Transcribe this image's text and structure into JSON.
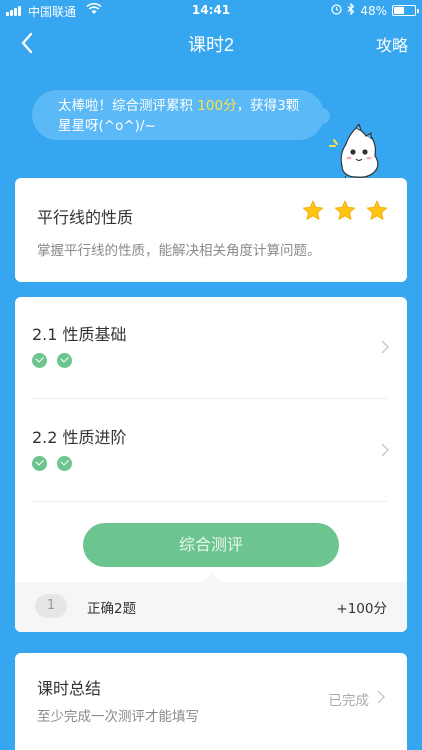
{
  "status_bar": {
    "carrier": "中国联通",
    "time": "14:41",
    "battery": "48%",
    "battery_level": 0.48,
    "icons": [
      "signal-icon",
      "wifi-icon",
      "alarm-icon",
      "bluetooth-icon",
      "battery-icon"
    ]
  },
  "nav": {
    "title": "课时2",
    "right_label": "攻略",
    "back_icon": "chevron-left-icon"
  },
  "bubble": {
    "text_before": "太棒啦！综合测评累积 ",
    "highlight": "100分",
    "text_after": "，获得3颗星星呀(^o^)/~"
  },
  "lesson": {
    "name": "平行线的性质",
    "description": "掌握平行线的性质，能解决相关角度计算问题。",
    "stars": 3
  },
  "sections": [
    {
      "name": "2.1 性质基础",
      "checks": 2
    },
    {
      "name": "2.2 性质进阶",
      "checks": 2
    }
  ],
  "evaluation": {
    "button_label": "综合测评",
    "attempt_number": "1",
    "result": "正确2题",
    "score": "+100分"
  },
  "summary": {
    "title": "课时总结",
    "hint": "至少完成一次测评才能填写",
    "status": "已完成"
  },
  "colors": {
    "background": "#35a6ef",
    "green": "#6cc58f",
    "star": "#ffc414",
    "highlight": "#ffe04a"
  }
}
